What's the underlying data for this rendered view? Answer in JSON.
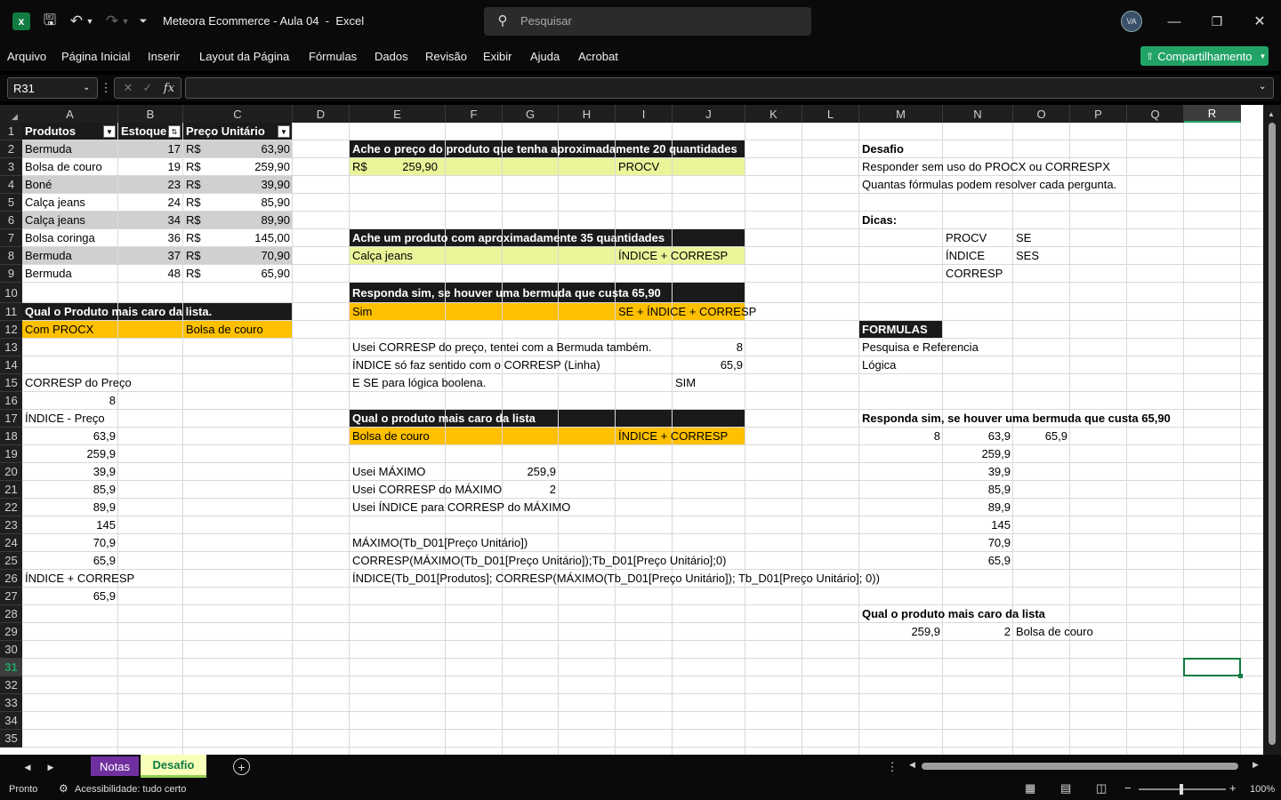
{
  "titlebar": {
    "doc_title": "Meteora Ecommerce - Aula 04  -  Excel",
    "search_placeholder": "Pesquisar"
  },
  "menu": [
    "Arquivo",
    "Página Inicial",
    "Inserir",
    "Layout da Página",
    "Fórmulas",
    "Dados",
    "Revisão",
    "Exibir",
    "Ajuda",
    "Acrobat"
  ],
  "share_label": "Compartilhamento",
  "namebox": "R31",
  "formula": "",
  "columns": [
    "A",
    "B",
    "C",
    "D",
    "E",
    "F",
    "G",
    "H",
    "I",
    "J",
    "K",
    "L",
    "M",
    "N",
    "O",
    "P",
    "Q",
    "R"
  ],
  "rows": [
    "1",
    "2",
    "3",
    "4",
    "5",
    "6",
    "7",
    "8",
    "9",
    "10",
    "11",
    "12",
    "13",
    "14",
    "15",
    "16",
    "17",
    "18",
    "19",
    "20",
    "21",
    "22",
    "23",
    "24",
    "25",
    "26",
    "27",
    "28",
    "29",
    "30",
    "31",
    "32",
    "33",
    "34",
    "35"
  ],
  "table": {
    "headers": [
      "Produtos",
      "Estoque",
      "Preço Unitário"
    ],
    "currency": "R$",
    "rows": [
      [
        "Bermuda",
        "17",
        "63,90"
      ],
      [
        "Bolsa de couro",
        "19",
        "259,90"
      ],
      [
        "Boné",
        "23",
        "39,90"
      ],
      [
        "Calça jeans",
        "24",
        "85,90"
      ],
      [
        "Calça jeans",
        "34",
        "89,90"
      ],
      [
        "Bolsa coringa",
        "36",
        "145,00"
      ],
      [
        "Bermuda",
        "37",
        "70,90"
      ],
      [
        "Bermuda",
        "48",
        "65,90"
      ]
    ]
  },
  "left": {
    "q_title": "Qual o Produto mais caro da lista.",
    "com_procx": "Com PROCX",
    "bolsa": "Bolsa de couro",
    "corresp_label": "CORRESP do Preço",
    "corresp_val": "8",
    "indice_label": "ÍNDICE - Preço",
    "indice_vals": [
      "63,9",
      "259,9",
      "39,9",
      "85,9",
      "89,9",
      "145",
      "70,9",
      "65,9"
    ],
    "ic_label": "ÍNDICE + CORRESP",
    "ic_val": "65,9"
  },
  "mid": {
    "q1": "Ache o preço do produto que tenha aproximadamente 20 quantidades",
    "q1_currency": "R$",
    "q1_value": "259,90",
    "q1_method": "PROCV",
    "q2": "Ache um produto com aproximadamente 35 quantidades",
    "q2_answer": "Calça jeans",
    "q2_method": "ÍNDICE + CORRESP",
    "q3": "Responda sim, se houver uma bermuda que custa 65,90",
    "q3_answer": "Sim",
    "q3_method": "SE + ÍNDICE + CORRESP",
    "n1": "Usei CORRESP do preço, tentei com a Bermuda também.",
    "n1v": "8",
    "n2": "ÍNDICE só faz sentido com o CORRESP (Linha)",
    "n2v": "65,9",
    "n3": "E SE para lógica boolena.",
    "n3v": "SIM",
    "q4": "Qual o produto mais caro da lista",
    "q4_answer": "Bolsa de couro",
    "q4_method": "ÍNDICE + CORRESP",
    "m1": "Usei MÁXIMO",
    "m1v": "259,9",
    "m2": "Usei CORRESP do MÁXIMO",
    "m2v": "2",
    "m3": "Usei ÍNDICE para CORRESP do MÁXIMO",
    "f1": "MÁXIMO(Tb_D01[Preço Unitário])",
    "f2": "CORRESP(MÁXIMO(Tb_D01[Preço Unitário]);Tb_D01[Preço Unitário];0)",
    "f3": "ÍNDICE(Tb_D01[Produtos]; CORRESP(MÁXIMO(Tb_D01[Preço Unitário]); Tb_D01[Preço Unitário]; 0))"
  },
  "right": {
    "desafio": "Desafio",
    "d1": "Responder sem uso do PROCX ou CORRESPX",
    "d2": "Quantas fórmulas podem resolver cada pergunta.",
    "dicas": "Dicas:",
    "procv": "PROCV",
    "se": "SE",
    "indice": "ÍNDICE",
    "ses": "SES",
    "corresp": "CORRESP",
    "formulas": "FORMULAS",
    "pesq": "Pesquisa e Referencia",
    "logica": "Lógica",
    "q3": "Responda sim, se houver uma bermuda que custa 65,90",
    "r18m": "8",
    "r18n": "63,9",
    "r18o": "65,9",
    "nvals": [
      "259,9",
      "39,9",
      "85,9",
      "89,9",
      "145",
      "70,9",
      "65,9"
    ],
    "q4": "Qual o produto mais caro da lista",
    "r29m": "259,9",
    "r29n": "2",
    "r29o": "Bolsa de couro"
  },
  "tabs": [
    "Notas",
    "Desafio"
  ],
  "status": {
    "ready": "Pronto",
    "access": "Acessibilidade: tudo certo",
    "zoom": "100%"
  },
  "colors": {
    "dark": "#1a1a1a",
    "yellow_light": "#eaf59a",
    "orange": "#ffc000",
    "grey_band": "#d0d0d0",
    "accent": "#21a366"
  }
}
